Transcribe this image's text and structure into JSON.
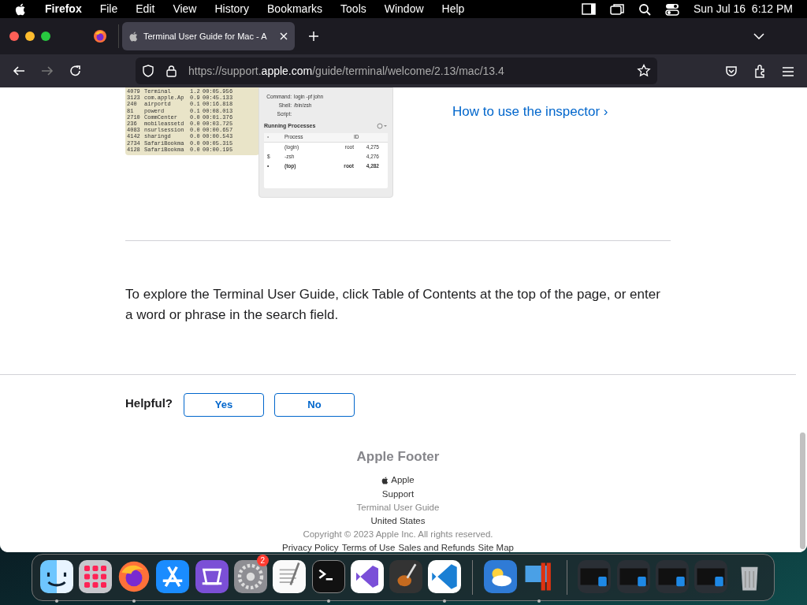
{
  "menu_bar": {
    "app": "Firefox",
    "items": [
      "File",
      "Edit",
      "View",
      "History",
      "Bookmarks",
      "Tools",
      "Window",
      "Help"
    ],
    "clock": "Sun Jul 16  6:12 PM"
  },
  "tabs": [
    {
      "title": "Terminal User Guide for Mac - A",
      "selected": true
    }
  ],
  "address_bar": {
    "prefix": "https://support.",
    "domain": "apple.com",
    "path": "/guide/terminal/welcome/2.13/mac/13.4"
  },
  "terminal_image": {
    "rows": [
      [
        "4079",
        "Terminal",
        "1.2",
        "00:05.95",
        "6"
      ],
      [
        "3123",
        "com.apple.Ap",
        "0.9",
        "00:45.13",
        "3"
      ],
      [
        "240",
        "airportd",
        "0.1",
        "00:16.81",
        "8"
      ],
      [
        "81",
        "powerd",
        "0.1",
        "00:08.01",
        "3"
      ],
      [
        "2710",
        "CommCenter",
        "0.0",
        "00:01.37",
        "6"
      ],
      [
        "236",
        "mobileassetd",
        "0.0",
        "00:03.72",
        "5"
      ],
      [
        "4083",
        "nsurlsession",
        "0.0",
        "00:00.65",
        "7"
      ],
      [
        "4142",
        "sharingd",
        "0.0",
        "00:00.54",
        "3"
      ],
      [
        "2734",
        "SafariBookma",
        "0.0",
        "00:05.31",
        "5"
      ],
      [
        "4128",
        "SafariBookma",
        "0.0",
        "00:00.19",
        "5"
      ]
    ]
  },
  "inspector_image": {
    "fields": [
      {
        "label": "Command:",
        "value": "login -pf john"
      },
      {
        "label": "Shell:",
        "value": "/bin/zsh"
      },
      {
        "label": "Script:"
      }
    ],
    "section": "Running Processes",
    "header_mark": "•",
    "columns": [
      "Process",
      "ID"
    ],
    "rows": [
      {
        "marker": "",
        "process": "(login)",
        "user": "root",
        "id": "4,275",
        "bold": false
      },
      {
        "marker": "$",
        "process": "-zsh",
        "user": "",
        "id": "4,276",
        "bold": false
      },
      {
        "marker": "•",
        "process": "(top)",
        "user": "root",
        "id": "4,282",
        "bold": true
      }
    ]
  },
  "inspector_link": "How to use the inspector ›",
  "paragraph": "To explore the Terminal User Guide, click Table of Contents at the top of the page, or enter a word or phrase in the search field.",
  "feedback": {
    "label": "Helpful?",
    "buttons": [
      "Yes",
      "No"
    ]
  },
  "footer": {
    "title": "Apple Footer",
    "breadcrumbs": [
      "Apple",
      "Support",
      "Terminal User Guide"
    ],
    "country": "United States",
    "copyright": "Copyright © 2023 Apple Inc. All rights reserved.",
    "links": [
      "Privacy Policy",
      "Terms of Use",
      "Sales and Refunds",
      "Site Map"
    ]
  },
  "dock": [
    {
      "kind": "finder",
      "running": true
    },
    {
      "kind": "launchpad",
      "running": false
    },
    {
      "kind": "firefox",
      "running": true
    },
    {
      "kind": "appstore",
      "running": false
    },
    {
      "kind": "configurator",
      "running": false
    },
    {
      "kind": "settings",
      "running": false,
      "badge": "2"
    },
    {
      "kind": "textedit",
      "running": false
    },
    {
      "kind": "terminal",
      "running": true
    },
    {
      "kind": "visualstudio",
      "running": false
    },
    {
      "kind": "garageband",
      "running": false
    },
    {
      "kind": "vscode",
      "running": true
    },
    {
      "kind": "divider"
    },
    {
      "kind": "weather",
      "running": false
    },
    {
      "kind": "parallels",
      "running": true
    },
    {
      "kind": "divider"
    },
    {
      "kind": "window"
    },
    {
      "kind": "window"
    },
    {
      "kind": "window"
    },
    {
      "kind": "window"
    },
    {
      "kind": "trash",
      "running": false
    }
  ]
}
